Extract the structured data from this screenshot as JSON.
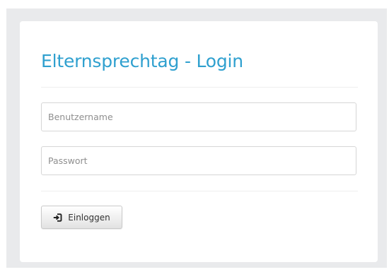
{
  "login": {
    "title": "Elternsprechtag - Login",
    "username": {
      "placeholder": "Benutzername",
      "value": ""
    },
    "password": {
      "placeholder": "Passwort",
      "value": ""
    },
    "submit": {
      "label": "Einloggen",
      "icon": "login-icon"
    }
  },
  "colors": {
    "title": "#2fa0cf",
    "backdrop": "#e9eaec"
  }
}
